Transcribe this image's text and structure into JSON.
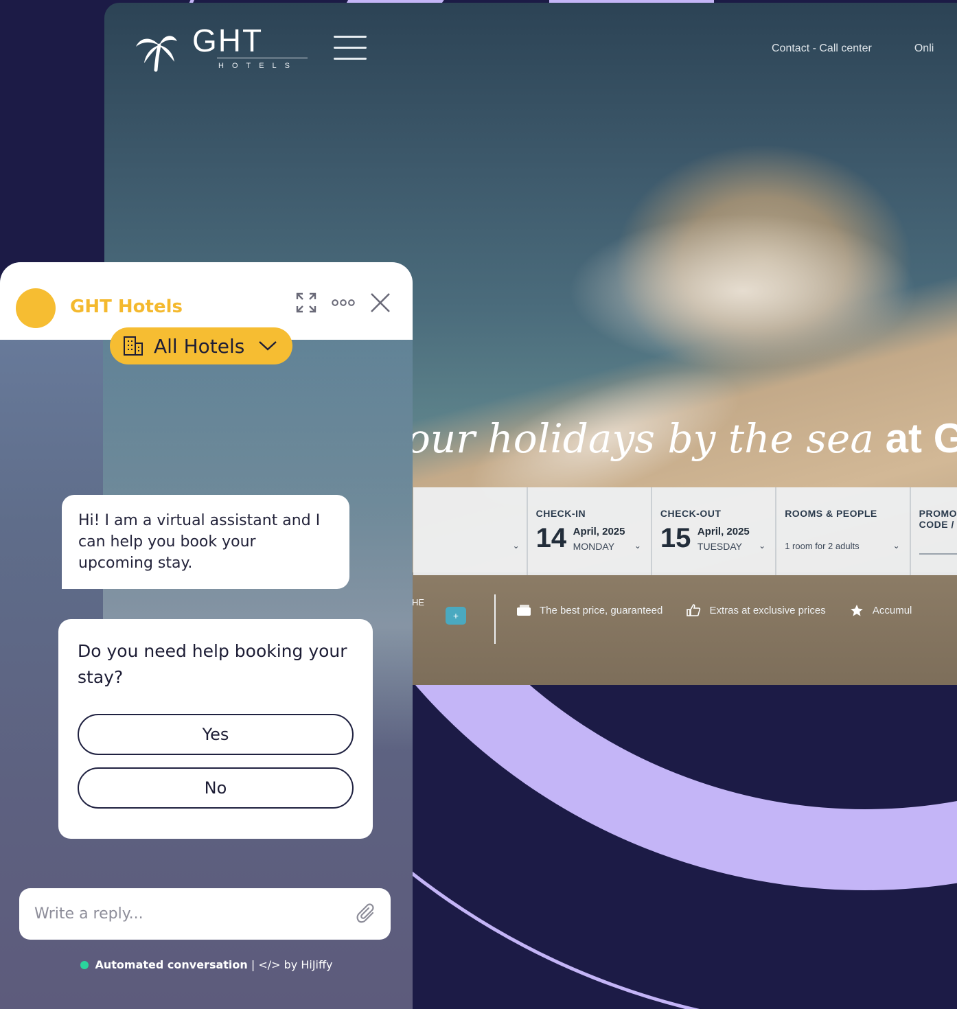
{
  "colors": {
    "page_bg": "#1c1b46",
    "arc": "#c4b5f7",
    "chat_accent": "#f6bd32",
    "status_dot": "#2ad49c"
  },
  "site": {
    "logo_word": "GHT",
    "logo_sub": "HOTELS",
    "nav": [
      "Contact - Call center",
      "Onli"
    ],
    "headline_italic": "our holidays by the sea",
    "headline_bold": " at GHT",
    "booking": {
      "checkin": {
        "label": "CHECK-IN",
        "day": "14",
        "month": "April, 2025",
        "weekday": "MONDAY"
      },
      "checkout": {
        "label": "CHECK-OUT",
        "day": "15",
        "month": "April, 2025",
        "weekday": "TUESDAY"
      },
      "rooms": {
        "label": "ROOMS & PEOPLE",
        "value": "1 room for 2 adults"
      },
      "promo": {
        "label": "PROMO CODE /"
      }
    },
    "he_fragment": "HE",
    "perks": [
      "The best price, guaranteed",
      "Extras at exclusive prices",
      "Accumul"
    ]
  },
  "chat": {
    "brand": "GHT Hotels",
    "hotel_selector": "All Hotels",
    "icons": [
      "expand-icon",
      "more-icon",
      "close-icon"
    ],
    "bot_message": "Hi! I am a virtual assistant and I can help you book your upcoming stay.",
    "question": "Do you need help booking your stay?",
    "options": [
      "Yes",
      "No"
    ],
    "reply_placeholder": "Write a reply...",
    "footer_bold": "Automated conversation",
    "footer_sep": " | ",
    "footer_code": "</>",
    "footer_by": " by HiJiffy"
  }
}
